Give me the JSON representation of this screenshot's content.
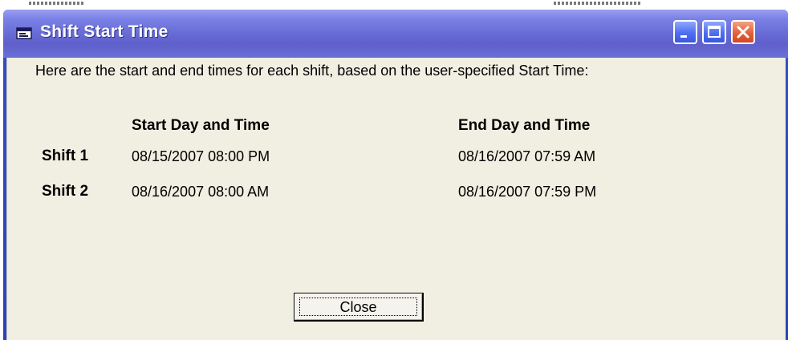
{
  "window": {
    "title": "Shift Start Time"
  },
  "content": {
    "intro": "Here are the start and end times for each shift, based on the user-specified Start Time:",
    "columns": [
      "Start Day and Time",
      "End Day and Time"
    ],
    "shifts": [
      {
        "label": "Shift 1",
        "start": "08/15/2007 08:00 PM",
        "end": "08/16/2007 07:59 AM"
      },
      {
        "label": "Shift 2",
        "start": "08/16/2007 08:00 AM",
        "end": "08/16/2007 07:59 PM"
      }
    ]
  },
  "buttons": {
    "close_label": "Close"
  },
  "icons": {
    "app": "window-icon",
    "minimize": "minimize-icon",
    "maximize": "maximize-icon",
    "close": "close-icon"
  },
  "colors": {
    "titlebar": "#6a6fd8",
    "client_background": "#f1efe2",
    "close_button_red": "#e2603a",
    "caption_button_blue": "#4d6ef2"
  }
}
